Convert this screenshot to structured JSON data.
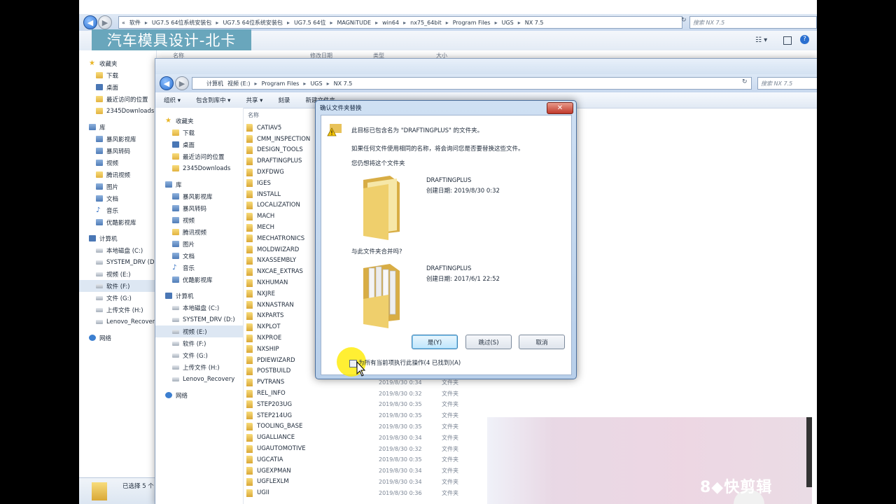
{
  "watermark": "汽车模具设计-北卡",
  "logo_text": "8◆快剪辑",
  "back_window": {
    "breadcrumb": [
      "«",
      "软件",
      "UG7.5 64位系统安装包",
      "UG7.5 64位系统安装包",
      "UG7.5 64位",
      "MAGNiTUDE",
      "win64",
      "nx75_64bit",
      "Program Files",
      "UGS",
      "NX 7.5"
    ],
    "search_placeholder": "搜索 NX 7.5",
    "headers": [
      "名称",
      "修改日期",
      "类型",
      "大小"
    ],
    "sidebar": [
      {
        "label": "收藏夹",
        "icon": "star-icon",
        "group": true
      },
      {
        "label": "下载",
        "icon": "folder-icon"
      },
      {
        "label": "桌面",
        "icon": "desktop-icon"
      },
      {
        "label": "最近访问的位置",
        "icon": "folder-icon"
      },
      {
        "label": "2345Downloads",
        "icon": "folder-icon"
      },
      {
        "label": "库",
        "icon": "library-icon",
        "group": true
      },
      {
        "label": "暴风影视库",
        "icon": "library-icon"
      },
      {
        "label": "暴风转码",
        "icon": "library-icon"
      },
      {
        "label": "视频",
        "icon": "library-icon"
      },
      {
        "label": "腾讯视频",
        "icon": "folder-icon"
      },
      {
        "label": "图片",
        "icon": "library-icon"
      },
      {
        "label": "文档",
        "icon": "library-icon"
      },
      {
        "label": "音乐",
        "icon": "music-icon"
      },
      {
        "label": "优酷影视库",
        "icon": "library-icon"
      },
      {
        "label": "计算机",
        "icon": "computer-icon",
        "group": true
      },
      {
        "label": "本地磁盘 (C:)",
        "icon": "drive-icon"
      },
      {
        "label": "SYSTEM_DRV (D:)",
        "icon": "drive-icon"
      },
      {
        "label": "视频 (E:)",
        "icon": "drive-icon"
      },
      {
        "label": "软件 (F:)",
        "icon": "drive-icon",
        "selected": true
      },
      {
        "label": "文件 (G:)",
        "icon": "drive-icon"
      },
      {
        "label": "上传文件 (H:)",
        "icon": "drive-icon"
      },
      {
        "label": "Lenovo_Recovery",
        "icon": "recovery-icon"
      },
      {
        "label": "网络",
        "icon": "network-icon",
        "group": true
      }
    ],
    "status": "已选择 5 个"
  },
  "front_window": {
    "breadcrumb": [
      "计算机",
      "视频 (E:)",
      "Program Files",
      "UGS",
      "NX 7.5"
    ],
    "search_placeholder": "搜索 NX 7.5",
    "toolbar": [
      "组织 ▾",
      "包含到库中 ▾",
      "共享 ▾",
      "刻录",
      "新建文件夹"
    ],
    "column_name": "名称",
    "sidebar": [
      {
        "label": "收藏夹",
        "icon": "star-icon",
        "group": true
      },
      {
        "label": "下载",
        "icon": "folder-icon"
      },
      {
        "label": "桌面",
        "icon": "desktop-icon"
      },
      {
        "label": "最近访问的位置",
        "icon": "folder-icon"
      },
      {
        "label": "2345Downloads",
        "icon": "folder-icon"
      },
      {
        "label": "库",
        "icon": "library-icon",
        "group": true
      },
      {
        "label": "暴风影视库",
        "icon": "library-icon"
      },
      {
        "label": "暴风转码",
        "icon": "library-icon"
      },
      {
        "label": "视频",
        "icon": "library-icon"
      },
      {
        "label": "腾讯视频",
        "icon": "folder-icon"
      },
      {
        "label": "图片",
        "icon": "library-icon"
      },
      {
        "label": "文档",
        "icon": "library-icon"
      },
      {
        "label": "音乐",
        "icon": "music-icon"
      },
      {
        "label": "优酷影视库",
        "icon": "library-icon"
      },
      {
        "label": "计算机",
        "icon": "computer-icon",
        "group": true
      },
      {
        "label": "本地磁盘 (C:)",
        "icon": "drive-icon"
      },
      {
        "label": "SYSTEM_DRV (D:)",
        "icon": "drive-icon"
      },
      {
        "label": "视频 (E:)",
        "icon": "drive-icon",
        "selected": true
      },
      {
        "label": "软件 (F:)",
        "icon": "drive-icon"
      },
      {
        "label": "文件 (G:)",
        "icon": "drive-icon"
      },
      {
        "label": "上传文件 (H:)",
        "icon": "drive-icon"
      },
      {
        "label": "Lenovo_Recovery",
        "icon": "recovery-icon"
      },
      {
        "label": "网络",
        "icon": "network-icon",
        "group": true
      }
    ],
    "files": [
      {
        "name": "CATIAV5",
        "date": "",
        "type": ""
      },
      {
        "name": "CMM_INSPECTION",
        "date": "",
        "type": ""
      },
      {
        "name": "DESIGN_TOOLS",
        "date": "",
        "type": ""
      },
      {
        "name": "DRAFTINGPLUS",
        "date": "",
        "type": ""
      },
      {
        "name": "DXFDWG",
        "date": "",
        "type": ""
      },
      {
        "name": "IGES",
        "date": "",
        "type": ""
      },
      {
        "name": "INSTALL",
        "date": "",
        "type": ""
      },
      {
        "name": "LOCALIZATION",
        "date": "",
        "type": ""
      },
      {
        "name": "MACH",
        "date": "",
        "type": ""
      },
      {
        "name": "MECH",
        "date": "",
        "type": ""
      },
      {
        "name": "MECHATRONICS",
        "date": "",
        "type": ""
      },
      {
        "name": "MOLDWIZARD",
        "date": "",
        "type": ""
      },
      {
        "name": "NXASSEMBLY",
        "date": "",
        "type": ""
      },
      {
        "name": "NXCAE_EXTRAS",
        "date": "",
        "type": ""
      },
      {
        "name": "NXHUMAN",
        "date": "",
        "type": ""
      },
      {
        "name": "NXJRE",
        "date": "",
        "type": ""
      },
      {
        "name": "NXNASTRAN",
        "date": "",
        "type": ""
      },
      {
        "name": "NXPARTS",
        "date": "",
        "type": ""
      },
      {
        "name": "NXPLOT",
        "date": "",
        "type": ""
      },
      {
        "name": "NXPROE",
        "date": "",
        "type": ""
      },
      {
        "name": "NXSHIP",
        "date": "",
        "type": ""
      },
      {
        "name": "PDIEWIZARD",
        "date": "",
        "type": ""
      },
      {
        "name": "POSTBUILD",
        "date": "",
        "type": ""
      },
      {
        "name": "PVTRANS",
        "date": "2019/8/30 0:34",
        "type": "文件夹"
      },
      {
        "name": "REL_INFO",
        "date": "2019/8/30 0:32",
        "type": "文件夹"
      },
      {
        "name": "STEP203UG",
        "date": "2019/8/30 0:35",
        "type": "文件夹"
      },
      {
        "name": "STEP214UG",
        "date": "2019/8/30 0:35",
        "type": "文件夹"
      },
      {
        "name": "TOOLING_BASE",
        "date": "2019/8/30 0:35",
        "type": "文件夹"
      },
      {
        "name": "UGALLIANCE",
        "date": "2019/8/30 0:34",
        "type": "文件夹"
      },
      {
        "name": "UGAUTOMOTIVE",
        "date": "2019/8/30 0:32",
        "type": "文件夹"
      },
      {
        "name": "UGCATIA",
        "date": "2019/8/30 0:35",
        "type": "文件夹"
      },
      {
        "name": "UGEXPMAN",
        "date": "2019/8/30 0:34",
        "type": "文件夹"
      },
      {
        "name": "UGFLEXLM",
        "date": "2019/8/30 0:34",
        "type": "文件夹"
      },
      {
        "name": "UGII",
        "date": "2019/8/30 0:36",
        "type": "文件夹"
      }
    ]
  },
  "dialog": {
    "title": "确认文件夹替换",
    "message": "此目标已包含名为 \"DRAFTINGPLUS\" 的文件夹。",
    "detail": "如果任何文件使用相同的名称，将会询问您是否要替换这些文件。",
    "question": "您仍想将这个文件夹",
    "target_name": "DRAFTINGPLUS",
    "target_date": "创建日期: 2019/8/30 0:32",
    "merge_question": "与此文件夹合并吗?",
    "source_name": "DRAFTINGPLUS",
    "source_date": "创建日期: 2017/6/1 22:52",
    "yes_button": "是(Y)",
    "skip_button": "跳过(S)",
    "cancel_button": "取消",
    "checkbox_label": "为所有当前项执行此操作(4 已找到)(A)"
  },
  "colors": {
    "accent": "#3c7fb1",
    "watermark_bg": "#69a6bc",
    "cursor_halo": "#ffeb00"
  }
}
